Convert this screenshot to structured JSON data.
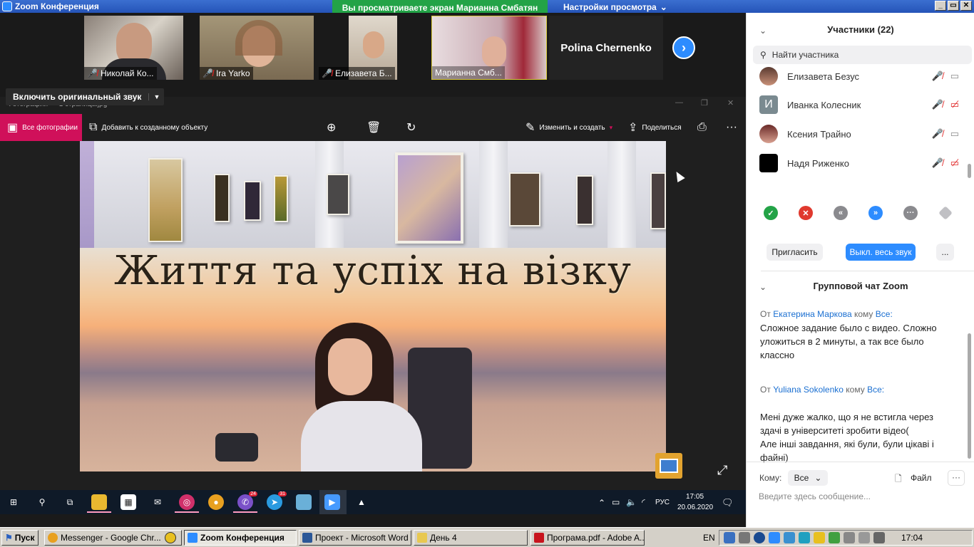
{
  "window": {
    "title": "Zoom Конференция",
    "share_banner": "Вы просматриваете экран Марианна Смбатян",
    "view_settings": "Настройки просмотра",
    "controls": [
      "_",
      "▭",
      "✕"
    ]
  },
  "video_strip": {
    "tiles": [
      {
        "name": "Николай Ко..."
      },
      {
        "name": "Ira Yarko"
      },
      {
        "name": "Елизавета Б..."
      },
      {
        "name": "Марианна Смб..."
      }
    ],
    "name_only_tile": "Polina Chernenko"
  },
  "original_sound": "Включить оригинальный звук",
  "photos_app": {
    "title": "Фотографии — 1 страница.jpg",
    "all_photos": "Все фотографии",
    "add_to_creation": "Добавить к созданному объекту",
    "edit_create": "Изменить и создать",
    "share": "Поделиться",
    "slide_title": "Життя та успіх на візку"
  },
  "taskbar": {
    "lang": "РУС",
    "time": "17:05",
    "date": "20.06.2020",
    "badges": {
      "viber": "24",
      "telegram": "31"
    }
  },
  "participants": {
    "header": "Участники (22)",
    "search_placeholder": "Найти участника",
    "list": [
      {
        "name": "Елизавета Безус",
        "initial": "",
        "cam_off": false
      },
      {
        "name": "Иванка Колесник",
        "initial": "И",
        "cam_off": true
      },
      {
        "name": "Ксения Трайно",
        "initial": "",
        "cam_off": false
      },
      {
        "name": "Надя Риженко",
        "initial": "",
        "cam_off": true
      }
    ],
    "invite": "Пригласить",
    "mute_all": "Выкл. весь звук",
    "more": "..."
  },
  "chat": {
    "header": "Групповой чат Zoom",
    "messages": [
      {
        "from_prefix": "От",
        "from": "Екатерина Маркова",
        "to_prefix": "кому",
        "to": "Все:",
        "text": "Сложное задание было с видео. Сложно уложиться в 2 минуты, а так все было классно"
      },
      {
        "from_prefix": "От",
        "from": "Yuliana Sokolenko",
        "to_prefix": "кому",
        "to": "Все:",
        "text": "Мені дуже жалко, що я не встигла через здачі в університеті зробити відео(\nАле інші завдання, які були, були цікаві і файні)"
      }
    ],
    "to_label": "Кому:",
    "to_value": "Все",
    "file": "Файл",
    "more": "···",
    "input_placeholder": "Введите здесь сообщение..."
  },
  "xp_taskbar": {
    "start": "Пуск",
    "tasks": [
      {
        "label": "Messenger - Google Chr...",
        "active": false
      },
      {
        "label": "Zoom Конференция",
        "active": true
      },
      {
        "label": "Проект - Microsoft Word",
        "active": false
      },
      {
        "label": "День 4",
        "active": false
      },
      {
        "label": "Програма.pdf - Adobe A...",
        "active": false
      }
    ],
    "lang": "EN",
    "time": "17:04"
  }
}
